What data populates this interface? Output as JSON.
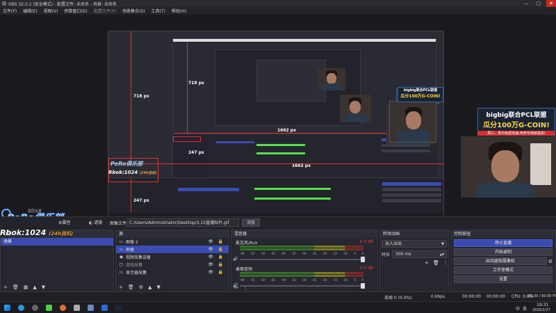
{
  "window": {
    "title": "OBS 32.0.2 (安全模式) - 配置文件: 未命名 - 场景: 未命名"
  },
  "menu": [
    "文件(F)",
    "编辑(E)",
    "视图(V)",
    "停靠窗口(D)",
    "配置文件(P)",
    "场景集合(S)",
    "工具(T)",
    "帮助(H)"
  ],
  "preview": {
    "label_718": "718 px",
    "label_1662": "1662 px",
    "label_247": "247 px",
    "nested_label_718": "718 px",
    "nested_label_1662": "1662 px",
    "nested_label_247": "247 px"
  },
  "banner": {
    "line1": "bigbig联合PCL联盟",
    "line2": "瓜分100万G-COIN!",
    "line3": "周三、周日免费加速,电竞专用就是快!"
  },
  "pero": {
    "logo": "PeRo俱乐部",
    "sub": "Rbok:1024",
    "sub2": "(24h挂机)"
  },
  "source_bar": {
    "mini_title": "图层设置",
    "props_icon": "⚙",
    "props_label": "属性",
    "filter_label": "滤镜",
    "image_label": "图像文件",
    "path": "C:/Users/Administrator/Desktop/3.15直播贴片.gif",
    "browse": "浏览"
  },
  "scenes": {
    "title": "场景",
    "items": [
      "场景"
    ]
  },
  "sources": {
    "title": "源",
    "items": [
      {
        "icon": "▭",
        "label": "图像 2"
      },
      {
        "icon": "▭",
        "label": "图像"
      },
      {
        "icon": "◉",
        "label": "视频采集设备"
      },
      {
        "icon": "▢",
        "label": "游戏采集"
      },
      {
        "icon": "▭",
        "label": "显示器采集"
      }
    ]
  },
  "mixer": {
    "title": "混音器",
    "tracks": [
      {
        "name": "麦克风/Aux",
        "db": "0.0 dB"
      },
      {
        "name": "桌面音频",
        "db": "0.0 dB"
      }
    ],
    "ticks": [
      "-60",
      "-55",
      "-50",
      "-45",
      "-40",
      "-35",
      "-30",
      "-25",
      "-20",
      "-15",
      "-10",
      "-5",
      "0"
    ]
  },
  "transitions": {
    "title": "转场动画",
    "selected": "淡入淡出",
    "duration_label": "时长",
    "duration": "300 ms"
  },
  "controls": {
    "title": "控制按钮",
    "buttons": [
      "停止直播",
      "开始录制",
      "启动虚拟摄像机",
      "工作室模式",
      "设置"
    ]
  },
  "status": {
    "dropped": "丢帧 0 (0.0%)",
    "kbps": "0 kbps",
    "time1": "00:00:00",
    "time2": "00:00:00",
    "cpu": "CPU: 0.8%",
    "fps": "60.00 / 60.00 FPS"
  },
  "taskbar": {
    "time": "19:31",
    "date": "2026/3/27",
    "ime": "中",
    "lang": "英"
  },
  "colors": {
    "accent": "#3a4cb0",
    "guide": "#e03030",
    "bg": "#1f1f23"
  }
}
